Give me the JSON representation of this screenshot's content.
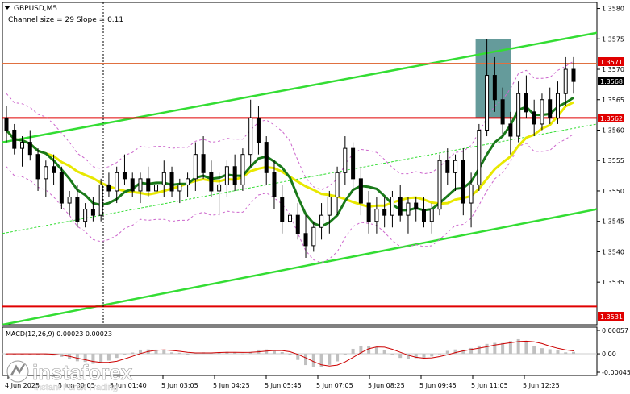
{
  "header": {
    "symbol": "GBPUSD,M5",
    "channel_info": "Channel size = 29 Slope = 0.11"
  },
  "macd": {
    "label": "MACD(12,26,9) 0.00023 0.00023",
    "ticks": [
      "0.00057",
      "0.00",
      "-0.00045"
    ],
    "levels": [
      0.00057,
      0.0,
      -0.00045
    ]
  },
  "price_axis": {
    "ticks": [
      "1.3580",
      "1.3575",
      "1.3570",
      "1.3565",
      "1.3560",
      "1.3555",
      "1.3550",
      "1.3545",
      "1.3540",
      "1.3535"
    ],
    "current_price": "1.3568",
    "level_upper": "1.3571",
    "level_mid": "1.3562",
    "level_lower": "1.3531"
  },
  "time_axis": {
    "labels": [
      "4 Jun 2025",
      "5 Jun 00:05",
      "5 Jun 01:40",
      "5 Jun 03:05",
      "5 Jun 04:25",
      "5 Jun 05:45",
      "5 Jun 07:05",
      "5 Jun 08:25",
      "5 Jun 09:45",
      "5 Jun 11:05",
      "5 Jun 12:25"
    ]
  },
  "watermark": {
    "brand": "instaforex",
    "tagline": "Instant Forex Trading"
  },
  "colors": {
    "bull_candle": "#000000",
    "bear_candle": "#000000",
    "sma_fast": "#1a7a1a",
    "sma_slow": "#e8e800",
    "channel": "#33dd33",
    "level_line": "#e00000",
    "envelope": "#cc66cc",
    "highlight_box": "#4a8a8a",
    "macd_hist": "#c0c0c0",
    "macd_signal": "#cc0000"
  },
  "chart_data": {
    "type": "candlestick",
    "symbol": "GBPUSD",
    "timeframe": "M5",
    "ylim": [
      1.3528,
      1.3581
    ],
    "horizontal_levels": [
      1.3571,
      1.3562,
      1.3531
    ],
    "last_price": 1.3568,
    "candles_ohlc": [
      [
        1.3562,
        1.3564,
        1.3558,
        1.356
      ],
      [
        1.356,
        1.3561,
        1.3556,
        1.3557
      ],
      [
        1.3557,
        1.3559,
        1.3554,
        1.3558
      ],
      [
        1.3558,
        1.356,
        1.3555,
        1.3556
      ],
      [
        1.3556,
        1.3557,
        1.355,
        1.3552
      ],
      [
        1.3552,
        1.3555,
        1.3549,
        1.3554
      ],
      [
        1.3554,
        1.3556,
        1.3551,
        1.3553
      ],
      [
        1.3553,
        1.3554,
        1.3547,
        1.3548
      ],
      [
        1.3548,
        1.355,
        1.3546,
        1.3549
      ],
      [
        1.3549,
        1.3551,
        1.3544,
        1.3545
      ],
      [
        1.3545,
        1.3548,
        1.3544,
        1.3547
      ],
      [
        1.3547,
        1.3549,
        1.3545,
        1.3546
      ],
      [
        1.3546,
        1.3552,
        1.3545,
        1.3551
      ],
      [
        1.3551,
        1.3553,
        1.3549,
        1.355
      ],
      [
        1.355,
        1.3554,
        1.3548,
        1.3553
      ],
      [
        1.3553,
        1.3556,
        1.3551,
        1.3552
      ],
      [
        1.3552,
        1.3553,
        1.3549,
        1.355
      ],
      [
        1.355,
        1.3553,
        1.3548,
        1.3552
      ],
      [
        1.3552,
        1.3554,
        1.3549,
        1.355
      ],
      [
        1.355,
        1.3552,
        1.3548,
        1.3551
      ],
      [
        1.3551,
        1.3555,
        1.3549,
        1.3553
      ],
      [
        1.3553,
        1.3554,
        1.3549,
        1.355
      ],
      [
        1.355,
        1.3552,
        1.3548,
        1.3551
      ],
      [
        1.3551,
        1.3553,
        1.3549,
        1.3552
      ],
      [
        1.3552,
        1.3558,
        1.355,
        1.3556
      ],
      [
        1.3556,
        1.3559,
        1.3552,
        1.3553
      ],
      [
        1.3553,
        1.3555,
        1.3549,
        1.355
      ],
      [
        1.355,
        1.3553,
        1.3546,
        1.3551
      ],
      [
        1.3551,
        1.3555,
        1.3549,
        1.3554
      ],
      [
        1.3554,
        1.3556,
        1.355,
        1.3551
      ],
      [
        1.3551,
        1.3557,
        1.355,
        1.3556
      ],
      [
        1.3556,
        1.3565,
        1.3554,
        1.3562
      ],
      [
        1.3562,
        1.3564,
        1.3556,
        1.3558
      ],
      [
        1.3558,
        1.3559,
        1.3551,
        1.3553
      ],
      [
        1.3553,
        1.3555,
        1.3547,
        1.3549
      ],
      [
        1.3549,
        1.3551,
        1.3543,
        1.3545
      ],
      [
        1.3545,
        1.3547,
        1.3542,
        1.3546
      ],
      [
        1.3546,
        1.3548,
        1.3542,
        1.3543
      ],
      [
        1.3543,
        1.3546,
        1.3539,
        1.3541
      ],
      [
        1.3541,
        1.3545,
        1.354,
        1.3544
      ],
      [
        1.3544,
        1.3548,
        1.3542,
        1.3546
      ],
      [
        1.3546,
        1.355,
        1.3543,
        1.3549
      ],
      [
        1.3549,
        1.3554,
        1.3546,
        1.3553
      ],
      [
        1.3553,
        1.3559,
        1.3551,
        1.3557
      ],
      [
        1.3557,
        1.3558,
        1.355,
        1.3552
      ],
      [
        1.3552,
        1.3554,
        1.3546,
        1.3548
      ],
      [
        1.3548,
        1.355,
        1.3543,
        1.3545
      ],
      [
        1.3545,
        1.3549,
        1.3543,
        1.3547
      ],
      [
        1.3547,
        1.3549,
        1.3544,
        1.3546
      ],
      [
        1.3546,
        1.355,
        1.3544,
        1.3549
      ],
      [
        1.3549,
        1.3551,
        1.3545,
        1.3546
      ],
      [
        1.3546,
        1.3549,
        1.3543,
        1.3548
      ],
      [
        1.3548,
        1.3549,
        1.3545,
        1.3547
      ],
      [
        1.3547,
        1.3549,
        1.3544,
        1.3545
      ],
      [
        1.3545,
        1.3548,
        1.3543,
        1.3547
      ],
      [
        1.3547,
        1.3556,
        1.3546,
        1.3555
      ],
      [
        1.3555,
        1.3557,
        1.3551,
        1.3553
      ],
      [
        1.3553,
        1.3556,
        1.355,
        1.3555
      ],
      [
        1.3555,
        1.3557,
        1.3546,
        1.3548
      ],
      [
        1.3548,
        1.3553,
        1.3544,
        1.3551
      ],
      [
        1.3551,
        1.3561,
        1.355,
        1.356
      ],
      [
        1.356,
        1.3575,
        1.3559,
        1.3569
      ],
      [
        1.3569,
        1.3572,
        1.3563,
        1.3565
      ],
      [
        1.3565,
        1.3567,
        1.3559,
        1.3561
      ],
      [
        1.3561,
        1.3563,
        1.3556,
        1.3559
      ],
      [
        1.3559,
        1.3568,
        1.3558,
        1.3566
      ],
      [
        1.3566,
        1.3569,
        1.3562,
        1.3563
      ],
      [
        1.3563,
        1.3565,
        1.3559,
        1.3561
      ],
      [
        1.3561,
        1.3566,
        1.356,
        1.3565
      ],
      [
        1.3565,
        1.3567,
        1.3561,
        1.3562
      ],
      [
        1.3562,
        1.3568,
        1.3561,
        1.3566
      ],
      [
        1.3566,
        1.3572,
        1.3564,
        1.357
      ],
      [
        1.357,
        1.3572,
        1.3566,
        1.3568
      ]
    ]
  }
}
